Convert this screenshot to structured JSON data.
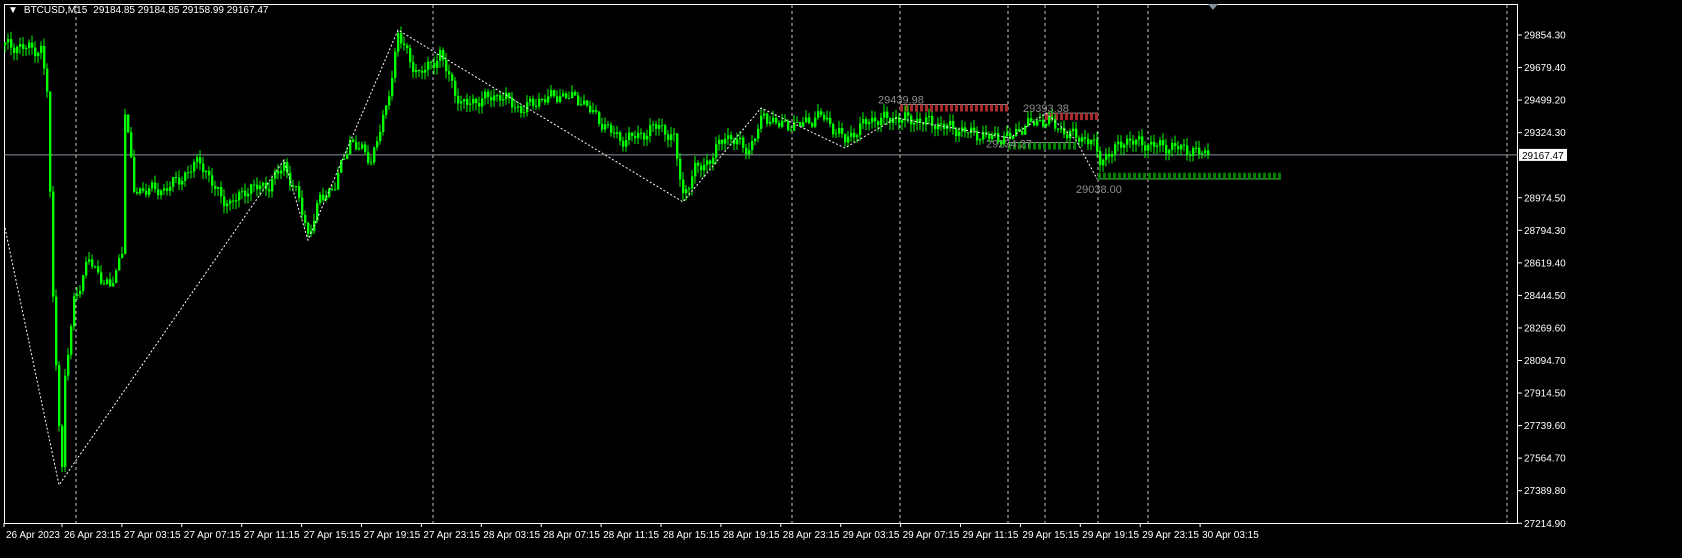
{
  "header": {
    "symbol": "BTCUSD,M15",
    "ohlc": "29184.85 29184.85 29158.99 29167.47"
  },
  "current_price": "29167.47",
  "chart_data": {
    "type": "candlestick",
    "symbol": "BTCUSD",
    "timeframe": "M15",
    "price_axis_labels": [
      "29854.30",
      "29679.40",
      "29499.20",
      "29324.30",
      "",
      "28974.50",
      "28794.30",
      "28619.40",
      "28444.50",
      "28269.60",
      "28094.70",
      "27914.50",
      "27739.60",
      "27564.70",
      "27389.80",
      "27214.90"
    ],
    "time_axis_labels": [
      "26 Apr 2023",
      "26 Apr 23:15",
      "27 Apr 03:15",
      "27 Apr 07:15",
      "27 Apr 11:15",
      "27 Apr 15:15",
      "27 Apr 19:15",
      "27 Apr 23:15",
      "28 Apr 03:15",
      "28 Apr 07:15",
      "28 Apr 11:15",
      "28 Apr 15:15",
      "28 Apr 19:15",
      "28 Apr 23:15",
      "29 Apr 03:15",
      "29 Apr 07:15",
      "29 Apr 11:15",
      "29 Apr 15:15",
      "29 Apr 19:15",
      "29 Apr 23:15",
      "30 Apr 03:15"
    ],
    "close_path_bar_price": [
      [
        0,
        29762
      ],
      [
        12,
        29735
      ],
      [
        14,
        29519
      ],
      [
        16,
        28383
      ],
      [
        18,
        27733
      ],
      [
        19,
        27463
      ],
      [
        20,
        27950
      ],
      [
        23,
        28383
      ],
      [
        28,
        28599
      ],
      [
        35,
        28437
      ],
      [
        39,
        28653
      ],
      [
        40,
        29410
      ],
      [
        43,
        28978
      ],
      [
        48,
        28978
      ],
      [
        53,
        28978
      ],
      [
        60,
        29059
      ],
      [
        65,
        29140
      ],
      [
        70,
        28978
      ],
      [
        75,
        28897
      ],
      [
        80,
        28978
      ],
      [
        88,
        29005
      ],
      [
        93,
        29113
      ],
      [
        98,
        28924
      ],
      [
        101,
        28734
      ],
      [
        105,
        28924
      ],
      [
        110,
        29005
      ],
      [
        115,
        29248
      ],
      [
        122,
        29140
      ],
      [
        127,
        29410
      ],
      [
        131,
        29816
      ],
      [
        135,
        29681
      ],
      [
        138,
        29600
      ],
      [
        145,
        29708
      ],
      [
        152,
        29437
      ],
      [
        158,
        29464
      ],
      [
        165,
        29491
      ],
      [
        172,
        29410
      ],
      [
        178,
        29464
      ],
      [
        185,
        29491
      ],
      [
        192,
        29464
      ],
      [
        198,
        29356
      ],
      [
        205,
        29248
      ],
      [
        212,
        29275
      ],
      [
        218,
        29329
      ],
      [
        223,
        29248
      ],
      [
        226,
        28951
      ],
      [
        230,
        29086
      ],
      [
        235,
        29140
      ],
      [
        240,
        29275
      ],
      [
        248,
        29194
      ],
      [
        253,
        29383
      ],
      [
        258,
        29329
      ],
      [
        265,
        29329
      ],
      [
        272,
        29383
      ],
      [
        280,
        29248
      ],
      [
        288,
        29356
      ],
      [
        297,
        29367
      ],
      [
        308,
        29345
      ],
      [
        318,
        29302
      ],
      [
        328,
        29264
      ],
      [
        335,
        29259
      ],
      [
        340,
        29329
      ],
      [
        347,
        29356
      ],
      [
        352,
        29302
      ],
      [
        357,
        29264
      ],
      [
        362,
        29248
      ],
      [
        365,
        29140
      ],
      [
        370,
        29194
      ],
      [
        373,
        29248
      ],
      [
        382,
        29221
      ],
      [
        392,
        29205
      ],
      [
        401,
        29167
      ]
    ],
    "zigzag_bar_price": [
      [
        0,
        28772
      ],
      [
        18,
        27382
      ],
      [
        93,
        29140
      ],
      [
        101,
        28707
      ],
      [
        131,
        29843
      ],
      [
        226,
        28913
      ],
      [
        252,
        29421
      ],
      [
        280,
        29205
      ],
      [
        297,
        29367
      ],
      [
        335,
        29259
      ],
      [
        347,
        29393
      ],
      [
        357,
        29248
      ],
      [
        364,
        29038
      ]
    ],
    "levels": [
      {
        "label": "29439.98",
        "price": 29439.98,
        "color": "#a52a2a"
      },
      {
        "label": "29393.38",
        "price": 29393.38,
        "color": "#a52a2a"
      },
      {
        "label": "29234.27",
        "price": 29234.27,
        "color": "#008000"
      },
      {
        "label": "29038.00",
        "price": 29038.0,
        "color": "#008000"
      }
    ]
  }
}
